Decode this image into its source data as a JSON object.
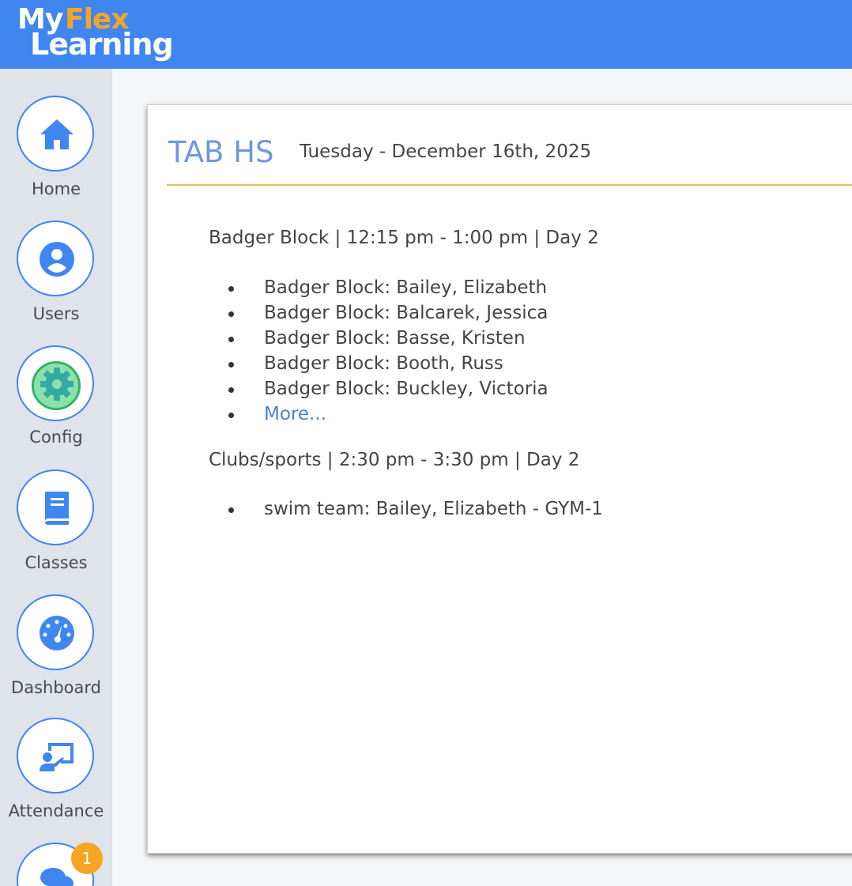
{
  "logo": {
    "my": "My",
    "flex": "Flex",
    "learning": "Learning"
  },
  "sidebar": {
    "items": [
      {
        "label": "Home",
        "icon": "home-icon"
      },
      {
        "label": "Users",
        "icon": "user-icon"
      },
      {
        "label": "Config",
        "icon": "gear-icon"
      },
      {
        "label": "Classes",
        "icon": "book-icon"
      },
      {
        "label": "Dashboard",
        "icon": "gauge-icon"
      },
      {
        "label": "Attendance",
        "icon": "presenter-icon"
      },
      {
        "label": "",
        "icon": "chat-icon",
        "badge": "1"
      }
    ]
  },
  "header": {
    "school": "TAB HS",
    "date": "Tuesday - December 16th, 2025"
  },
  "blocks": [
    {
      "title": "Badger Block  | 12:15 pm - 1:00 pm  | Day 2",
      "items": [
        "Badger Block: Bailey, Elizabeth",
        "Badger Block: Balcarek, Jessica",
        "Badger Block: Basse, Kristen",
        "Badger Block: Booth, Russ",
        "Badger Block: Buckley, Victoria"
      ],
      "more": "More..."
    },
    {
      "title": "Clubs/sports  | 2:30 pm - 3:30 pm  | Day 2",
      "items": [
        "swim team: Bailey, Elizabeth - GYM-1"
      ]
    }
  ],
  "colors": {
    "accent": "#3f86f1",
    "orange": "#f5a623",
    "divider": "#e9b95a",
    "link": "#4a7fd6"
  }
}
